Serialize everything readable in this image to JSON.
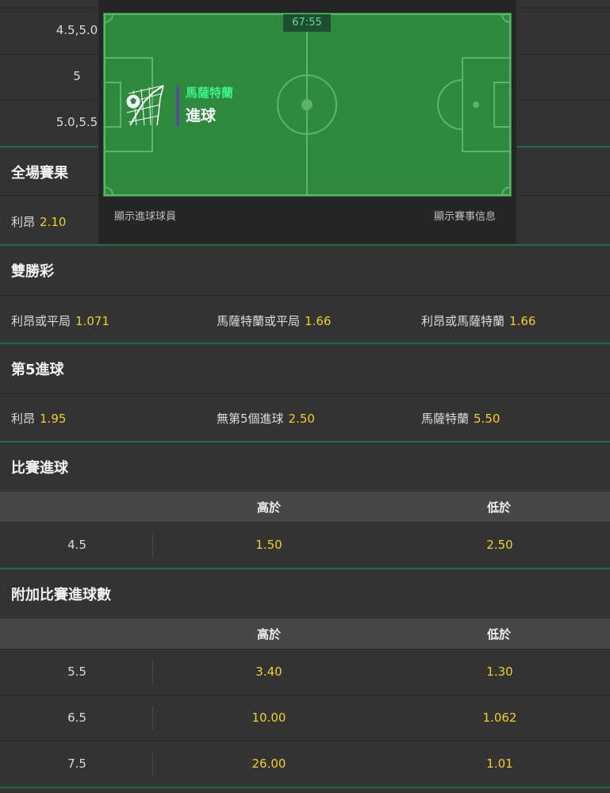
{
  "top_rows": [
    "4.5,5.0",
    "5",
    "5.0,5.5"
  ],
  "overlay": {
    "timer": "67:55",
    "team": "馬薩特蘭",
    "event": "進球",
    "show_scorer": "顯示進球球員",
    "show_info": "顯示賽事信息",
    "pitch_color": "#2e8b3e"
  },
  "full_time": {
    "title": "全場賽果",
    "team": "利昂",
    "odds": "2.10"
  },
  "double_chance": {
    "title": "雙勝彩",
    "options": [
      {
        "label": "利昂或平局",
        "odds": "1.071"
      },
      {
        "label": "馬薩特蘭或平局",
        "odds": "1.66"
      },
      {
        "label": "利昂或馬薩特蘭",
        "odds": "1.66"
      }
    ]
  },
  "fifth_goal": {
    "title": "第5進球",
    "options": [
      {
        "label": "利昂",
        "odds": "1.95"
      },
      {
        "label": "無第5個進球",
        "odds": "2.50"
      },
      {
        "label": "馬薩特蘭",
        "odds": "5.50"
      }
    ]
  },
  "match_goals": {
    "title": "比賽進球",
    "over_label": "高於",
    "under_label": "低於",
    "rows": [
      {
        "line": "4.5",
        "over": "1.50",
        "under": "2.50"
      }
    ]
  },
  "extra_goals": {
    "title": "附加比賽進球數",
    "over_label": "高於",
    "under_label": "低於",
    "rows": [
      {
        "line": "5.5",
        "over": "3.40",
        "under": "1.30"
      },
      {
        "line": "6.5",
        "over": "10.00",
        "under": "1.062"
      },
      {
        "line": "7.5",
        "over": "26.00",
        "under": "1.01"
      }
    ]
  },
  "colors": {
    "background": "#333333",
    "odds": "#f2d024",
    "accent_green": "#3ef08c",
    "divider": "#1e6b46"
  }
}
